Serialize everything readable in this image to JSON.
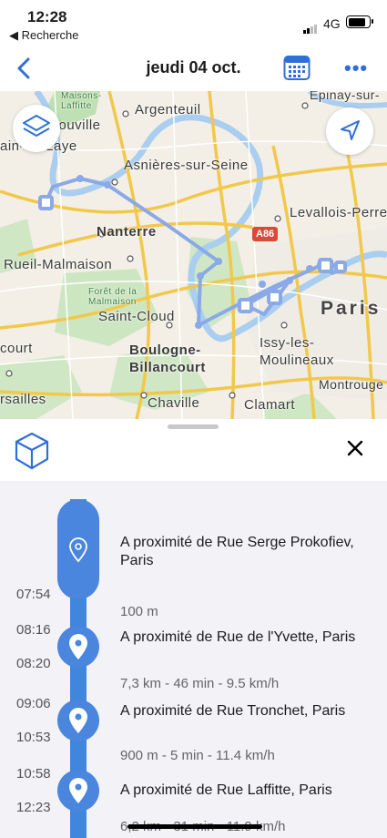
{
  "status_bar": {
    "time": "12:28",
    "back_app": "◀ Recherche",
    "network": "4G"
  },
  "nav": {
    "title": "jeudi 04 oct."
  },
  "map": {
    "labels": {
      "maisons": "Maisons-",
      "laffitte": "Laffitte",
      "sartrouville": "rouville",
      "saint_germain": "ain-en-Laye",
      "argenteuil": "Argenteuil",
      "epinay": "Epinay-sur-",
      "asnieres": "Asnières-sur-Seine",
      "levallois": "Levallois-Perret",
      "nanterre": "Nanterre",
      "rueil": "Rueil-Malmaison",
      "foret_1": "Forêt de la",
      "foret_2": "Malmaison",
      "saint_cloud": "Saint-Cloud",
      "paris": "Paris",
      "boulogne_1": "Boulogne-",
      "boulogne_2": "Billancourt",
      "issy_1": "Issy-les-",
      "issy_2": "Moulineaux",
      "croissy": "court",
      "montrouge": "Montrouge",
      "versailles": "rsailles",
      "chaville": "Chaville",
      "clamart": "Clamart",
      "a86": "A86"
    }
  },
  "timeline": {
    "entries": [
      {
        "place": "A proximité de Rue Serge Prokofiev, Paris",
        "time_end": "07:54",
        "meta": "100 m"
      },
      {
        "time_start": "08:16",
        "place": "A proximité de Rue de l'Yvette, Paris",
        "time_end": "08:20",
        "meta": "7,3 km - 46 min - 9.5 km/h"
      },
      {
        "time_start": "09:06",
        "place": "A proximité de Rue Tronchet, Paris",
        "time_end": "10:53",
        "meta": "900 m - 5 min - 11.4 km/h"
      },
      {
        "time_start": "10:58",
        "place": "A proximité de Rue Laffitte, Paris",
        "time_end": "12:23",
        "meta": "6,2 km - 31 min - 11.9 km/h"
      }
    ]
  },
  "colors": {
    "accent": "#2f6fd8",
    "timeline": "#4a86de",
    "route": "#8aa9e6"
  }
}
